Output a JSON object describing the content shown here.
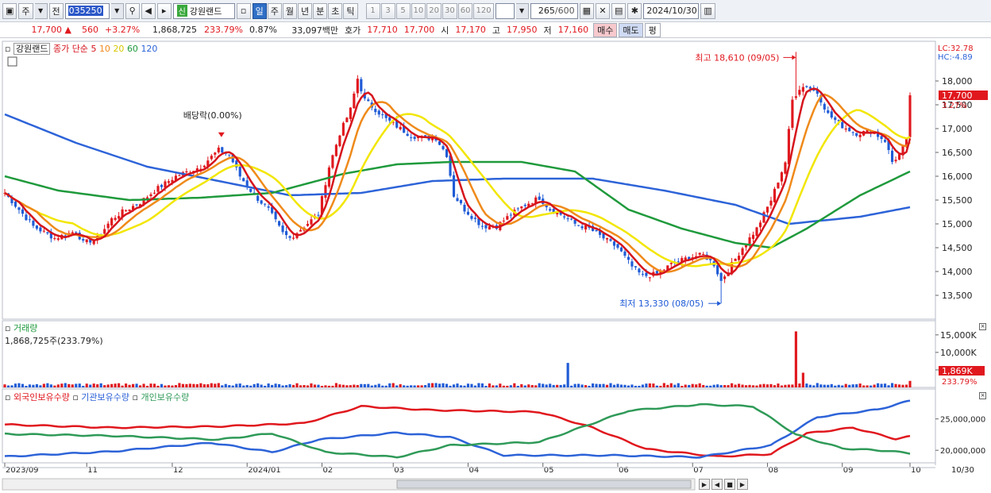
{
  "toolbar": {
    "market_btn": "주",
    "prev_btn": "전",
    "stock_code": "035250",
    "stock_badge": "신",
    "stock_name": "강원랜드",
    "periods": [
      "일",
      "주",
      "월",
      "년",
      "분",
      "초",
      "틱"
    ],
    "active_period": "일",
    "intervals": [
      "1",
      "3",
      "5",
      "10",
      "20",
      "30",
      "60",
      "120"
    ],
    "count_shown": "265",
    "count_total": "/600",
    "date": "2024/10/30"
  },
  "quote": {
    "price": "17,700",
    "change_arrow": "▲",
    "change": "560",
    "change_pct": "+3.27%",
    "volume": "1,868,725",
    "volume_ratio": "233.79%",
    "turnover": "0.87%",
    "amount": "33,097백만",
    "ask_label": "호가",
    "ask": "17,710",
    "bid": "17,700",
    "open_label": "시",
    "open": "17,170",
    "high_label": "고",
    "high": "17,950",
    "low_label": "저",
    "low": "17,160",
    "buy_label": "매수",
    "sell_label": "매도",
    "misc_label": "평"
  },
  "legend": {
    "stock_name": "강원랜드",
    "ma_label": "종가 단순",
    "ma_periods": [
      "5",
      "10",
      "20",
      "60",
      "120"
    ],
    "volume_title": "거래량",
    "volume_value": "1,868,725주(233.79%)",
    "holdings": [
      "외국인보유수량",
      "기관보유수량",
      "개인보유수량"
    ]
  },
  "annotations": {
    "lc": "LC:32.78",
    "hc": "HC:-4.89",
    "high": "최고 18,610 (09/05)",
    "low": "최저 13,330 (08/05)",
    "dividend": "배당락(0.00%)",
    "current_price": "17,700",
    "current_pct": "3.27%",
    "current_volume": "1,869K",
    "volume_pct": "233.79%"
  },
  "colors": {
    "up": "#e0181e",
    "down": "#1f5bd6",
    "ma5": "#d6141c",
    "ma10": "#ef8a1a",
    "ma20": "#f2e600",
    "ma60": "#1f9a3c",
    "ma120": "#2d63d8",
    "foreign": "#e0181e",
    "institution": "#2d63d8",
    "individual": "#2f9a58"
  },
  "chart_data": [
    {
      "type": "candlestick",
      "title": "강원랜드 일봉",
      "x_axis_ticks": [
        "2023/09",
        "11",
        "12",
        "2024/01",
        "02",
        "03",
        "04",
        "05",
        "06",
        "07",
        "08",
        "09",
        "10",
        "10/30"
      ],
      "y_ticks": [
        13500,
        14000,
        14500,
        15000,
        15500,
        16000,
        16500,
        17000,
        17500,
        18000
      ],
      "ylim": [
        13000,
        18700
      ],
      "last_close": 17700,
      "high": {
        "value": 18610,
        "date": "09/05"
      },
      "low": {
        "value": 13330,
        "date": "08/05"
      },
      "anchors": [
        [
          0,
          15650
        ],
        [
          8,
          14950
        ],
        [
          14,
          14700
        ],
        [
          20,
          14850
        ],
        [
          22,
          14600
        ],
        [
          26,
          14700
        ],
        [
          30,
          15100
        ],
        [
          33,
          15250
        ],
        [
          38,
          15450
        ],
        [
          42,
          15700
        ],
        [
          48,
          16000
        ],
        [
          55,
          16200
        ],
        [
          60,
          16550
        ],
        [
          63,
          16450
        ],
        [
          66,
          16000
        ],
        [
          70,
          15600
        ],
        [
          74,
          15300
        ],
        [
          78,
          14800
        ],
        [
          80,
          14700
        ],
        [
          84,
          14950
        ],
        [
          88,
          15200
        ],
        [
          91,
          16200
        ],
        [
          94,
          16900
        ],
        [
          97,
          17400
        ],
        [
          99,
          18050
        ],
        [
          101,
          17600
        ],
        [
          104,
          17400
        ],
        [
          107,
          17200
        ],
        [
          111,
          17000
        ],
        [
          114,
          16850
        ],
        [
          118,
          16800
        ],
        [
          121,
          16800
        ],
        [
          124,
          16450
        ],
        [
          126,
          15600
        ],
        [
          129,
          15300
        ],
        [
          134,
          14950
        ],
        [
          138,
          14950
        ],
        [
          142,
          15200
        ],
        [
          146,
          15400
        ],
        [
          150,
          15550
        ],
        [
          153,
          15300
        ],
        [
          156,
          15200
        ],
        [
          160,
          15000
        ],
        [
          164,
          14900
        ],
        [
          168,
          14700
        ],
        [
          172,
          14500
        ],
        [
          176,
          14100
        ],
        [
          179,
          13900
        ],
        [
          183,
          13950
        ],
        [
          187,
          14150
        ],
        [
          192,
          14300
        ],
        [
          196,
          14350
        ],
        [
          199,
          14150
        ],
        [
          201,
          13800
        ],
        [
          204,
          14150
        ],
        [
          207,
          14500
        ],
        [
          211,
          14900
        ],
        [
          215,
          15500
        ],
        [
          219,
          16300
        ],
        [
          221,
          17600
        ],
        [
          223,
          17850
        ],
        [
          225,
          17900
        ],
        [
          228,
          17750
        ],
        [
          231,
          17300
        ],
        [
          235,
          17050
        ],
        [
          239,
          16900
        ],
        [
          243,
          16950
        ],
        [
          247,
          16750
        ],
        [
          249,
          16300
        ],
        [
          251,
          16450
        ],
        [
          253,
          16750
        ],
        [
          254,
          17700
        ]
      ],
      "moving_averages": [
        {
          "name": "5",
          "color": "#d6141c"
        },
        {
          "name": "10",
          "color": "#ef8a1a"
        },
        {
          "name": "20",
          "color": "#f2e600"
        },
        {
          "name": "60",
          "color": "#1f9a3c"
        },
        {
          "name": "120",
          "color": "#2d63d8"
        }
      ],
      "ma120_anchors": [
        [
          0,
          17300
        ],
        [
          20,
          16700
        ],
        [
          40,
          16200
        ],
        [
          60,
          15900
        ],
        [
          80,
          15600
        ],
        [
          100,
          15650
        ],
        [
          120,
          15900
        ],
        [
          140,
          15950
        ],
        [
          165,
          15950
        ],
        [
          185,
          15700
        ],
        [
          205,
          15400
        ],
        [
          220,
          15000
        ],
        [
          240,
          15150
        ],
        [
          254,
          15350
        ]
      ],
      "ma60_anchors": [
        [
          0,
          16000
        ],
        [
          15,
          15700
        ],
        [
          35,
          15500
        ],
        [
          55,
          15550
        ],
        [
          75,
          15650
        ],
        [
          95,
          16050
        ],
        [
          110,
          16250
        ],
        [
          125,
          16300
        ],
        [
          145,
          16300
        ],
        [
          160,
          16100
        ],
        [
          175,
          15300
        ],
        [
          190,
          14900
        ],
        [
          205,
          14600
        ],
        [
          215,
          14500
        ],
        [
          225,
          14900
        ],
        [
          240,
          15600
        ],
        [
          254,
          16100
        ]
      ],
      "dividend_marker": {
        "index": 59,
        "label": "배당락(0.00%)"
      }
    },
    {
      "type": "bar",
      "title": "거래량",
      "y_ticks": [
        5000,
        10000,
        15000
      ],
      "ylim": [
        0,
        17000
      ],
      "unit": "K",
      "spikes": [
        {
          "index": 158,
          "value": 7000,
          "dir": "down"
        },
        {
          "index": 222,
          "value": 16000,
          "dir": "up"
        },
        {
          "index": 224,
          "value": 4200,
          "dir": "up"
        },
        {
          "index": 254,
          "value": 1869,
          "dir": "up"
        }
      ],
      "base_level": 900
    },
    {
      "type": "line",
      "title": "보유수량",
      "y_ticks": [
        20000000,
        25000000
      ],
      "ylim": [
        18000000,
        28500000
      ],
      "series": [
        {
          "name": "외국인보유수량",
          "color": "#e0181e",
          "anchors": [
            [
              0,
              24100000
            ],
            [
              30,
              23600000
            ],
            [
              60,
              23800000
            ],
            [
              84,
              24300000
            ],
            [
              100,
              27000000
            ],
            [
              120,
              26400000
            ],
            [
              150,
              26100000
            ],
            [
              165,
              23600000
            ],
            [
              180,
              20200000
            ],
            [
              200,
              19000000
            ],
            [
              215,
              19400000
            ],
            [
              225,
              22700000
            ],
            [
              238,
              23600000
            ],
            [
              250,
              21800000
            ],
            [
              254,
              22200000
            ]
          ]
        },
        {
          "name": "기관보유수량",
          "color": "#2d63d8",
          "anchors": [
            [
              0,
              19000000
            ],
            [
              30,
              19800000
            ],
            [
              58,
              21200000
            ],
            [
              75,
              19700000
            ],
            [
              88,
              21700000
            ],
            [
              110,
              22800000
            ],
            [
              125,
              22100000
            ],
            [
              140,
              19200000
            ],
            [
              170,
              19200000
            ],
            [
              195,
              18900000
            ],
            [
              215,
              20800000
            ],
            [
              228,
              25300000
            ],
            [
              245,
              26500000
            ],
            [
              254,
              27900000
            ]
          ]
        },
        {
          "name": "개인보유수량",
          "color": "#2f9a58",
          "anchors": [
            [
              0,
              22600000
            ],
            [
              30,
              22300000
            ],
            [
              60,
              21700000
            ],
            [
              75,
              22700000
            ],
            [
              90,
              19700000
            ],
            [
              110,
              18900000
            ],
            [
              125,
              20800000
            ],
            [
              150,
              21300000
            ],
            [
              175,
              26300000
            ],
            [
              195,
              27300000
            ],
            [
              210,
              27000000
            ],
            [
              222,
              22500000
            ],
            [
              235,
              20300000
            ],
            [
              248,
              19900000
            ],
            [
              254,
              19500000
            ]
          ]
        }
      ]
    }
  ]
}
